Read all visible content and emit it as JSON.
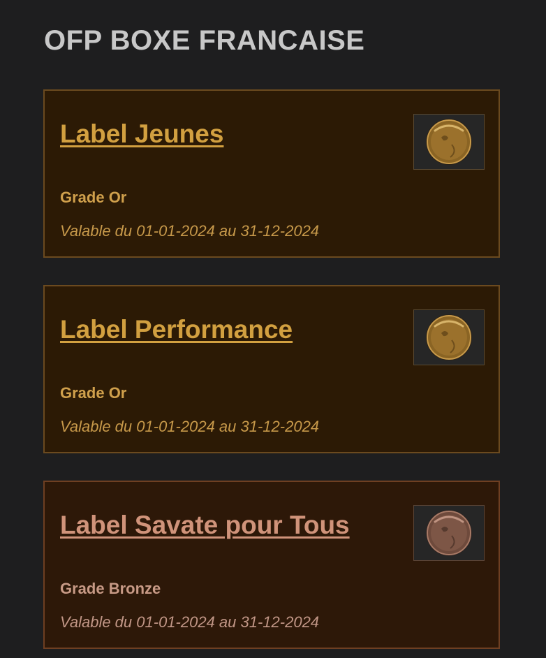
{
  "page": {
    "title": "OFP BOXE FRANCAISE"
  },
  "labels": [
    {
      "title": "Label Jeunes",
      "grade": "Grade Or",
      "validity": "Valable du 01-01-2024 au 31-12-2024",
      "medal": "gold-medal-icon",
      "accent": "#d2a040"
    },
    {
      "title": "Label Performance",
      "grade": "Grade Or",
      "validity": "Valable du 01-01-2024 au 31-12-2024",
      "medal": "gold-medal-icon",
      "accent": "#d2a040"
    },
    {
      "title": "Label Savate pour Tous",
      "grade": "Grade Bronze",
      "validity": "Valable du 01-01-2024 au 31-12-2024",
      "medal": "bronze-medal-icon",
      "accent": "#d0937a"
    }
  ]
}
